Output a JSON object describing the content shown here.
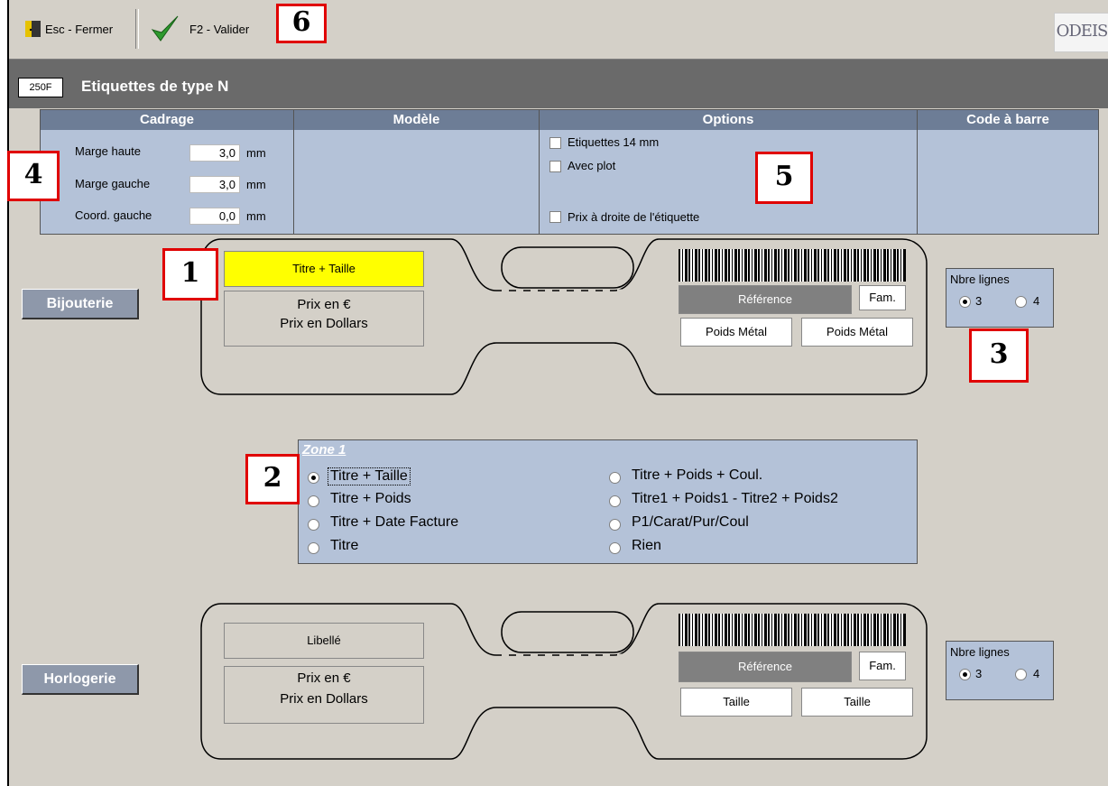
{
  "toolbar": {
    "close_label": "Esc - Fermer",
    "validate_label": "F2 - Valider",
    "logo_text": "ODEIS"
  },
  "window": {
    "title": "Etiquettes de type N",
    "icon_text": "250F"
  },
  "columns": {
    "cadrage": "Cadrage",
    "modele": "Modèle",
    "options": "Options",
    "code_barre": "Code à barre"
  },
  "cadrage": {
    "marge_haute_label": "Marge haute",
    "marge_haute_value": "3,0",
    "marge_gauche_label": "Marge gauche",
    "marge_gauche_value": "3,0",
    "coord_gauche_label": "Coord. gauche",
    "coord_gauche_value": "0,0",
    "unit": "mm"
  },
  "options": {
    "etiquettes14": "Etiquettes 14 mm",
    "avec_plot": "Avec plot",
    "prix_droite": "Prix à droite de l'étiquette"
  },
  "callouts": {
    "n1": "1",
    "n2": "2",
    "n3": "3",
    "n4": "4",
    "n5": "5",
    "n6": "6"
  },
  "bijouterie": {
    "button": "Bijouterie",
    "zone1": "Titre + Taille",
    "prix_euro": "Prix en €",
    "prix_dollars": "Prix en Dollars",
    "reference": "Référence",
    "fam": "Fam.",
    "poids1": "Poids Métal",
    "poids2": "Poids Métal",
    "nbre_title": "Nbre lignes",
    "opt3": "3",
    "opt4": "4",
    "selected": "3"
  },
  "zone": {
    "title": "Zone 1",
    "options": [
      "Titre + Taille",
      "Titre + Poids",
      "Titre + Date Facture",
      "Titre",
      "Titre + Poids + Coul.",
      "Titre1 + Poids1 - Titre2 + Poids2",
      "P1/Carat/Pur/Coul",
      "Rien"
    ],
    "selected": "Titre + Taille"
  },
  "horlogerie": {
    "button": "Horlogerie",
    "libelle": "Libellé",
    "prix_euro": "Prix en €",
    "prix_dollars": "Prix en Dollars",
    "reference": "Référence",
    "fam": "Fam.",
    "taille1": "Taille",
    "taille2": "Taille",
    "nbre_title": "Nbre lignes",
    "opt3": "3",
    "opt4": "4",
    "selected": "3"
  },
  "colors": {
    "panel": "#b4c2d8",
    "header": "#6d7d96",
    "accent_red": "#e00000",
    "highlight_yellow": "#ffff00"
  }
}
